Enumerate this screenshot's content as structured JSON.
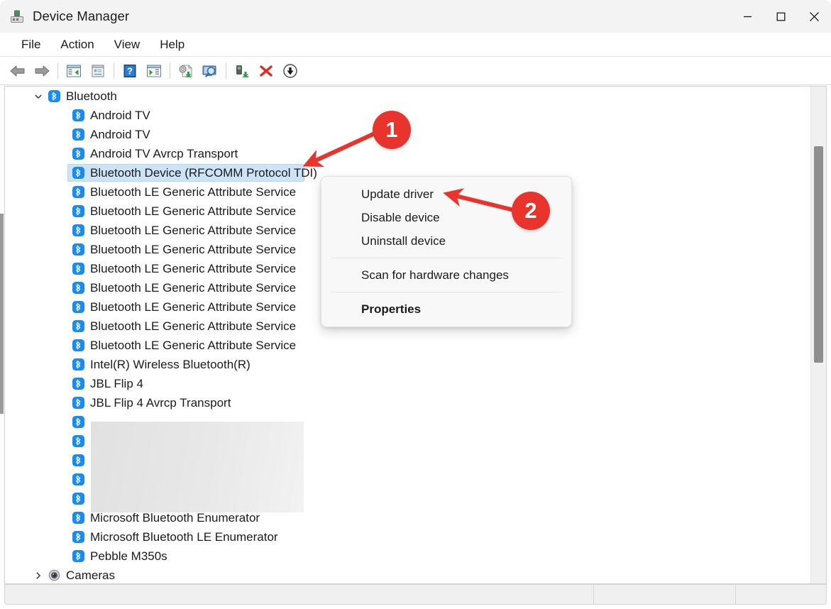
{
  "window": {
    "title": "Device Manager",
    "icon": "device-manager-icon",
    "controls": [
      {
        "name": "minimize",
        "glyph": "minimize-icon"
      },
      {
        "name": "maximize",
        "glyph": "maximize-icon"
      },
      {
        "name": "close",
        "glyph": "close-icon"
      }
    ]
  },
  "menubar": {
    "items": [
      "File",
      "Action",
      "View",
      "Help"
    ]
  },
  "toolbar": {
    "buttons": [
      {
        "name": "back-button",
        "icon": "back-arrow-icon"
      },
      {
        "name": "forward-button",
        "icon": "forward-arrow-icon"
      },
      {
        "name": "separator-1",
        "icon": "separator"
      },
      {
        "name": "show-hide-console-tree-button",
        "icon": "console-tree-icon"
      },
      {
        "name": "properties-button",
        "icon": "properties-window-icon"
      },
      {
        "name": "separator-2",
        "icon": "separator"
      },
      {
        "name": "help-button",
        "icon": "help-question-icon"
      },
      {
        "name": "show-hide-action-pane-button",
        "icon": "action-pane-icon"
      },
      {
        "name": "separator-3",
        "icon": "separator"
      },
      {
        "name": "update-driver-button",
        "icon": "update-driver-icon"
      },
      {
        "name": "scan-for-hardware-changes-button",
        "icon": "scan-monitor-icon"
      },
      {
        "name": "separator-4",
        "icon": "separator"
      },
      {
        "name": "enable-device-button",
        "icon": "enable-device-icon"
      },
      {
        "name": "uninstall-device-button",
        "icon": "red-x-icon"
      },
      {
        "name": "disable-device-button",
        "icon": "down-arrow-circle-icon"
      }
    ]
  },
  "tree": {
    "root_label": "Bluetooth",
    "root_expanded": true,
    "selected_index": 3,
    "items": [
      {
        "label": "Android TV",
        "icon": "bluetooth-icon",
        "redacted": false
      },
      {
        "label": "Android TV",
        "icon": "bluetooth-icon",
        "redacted": false
      },
      {
        "label": "Android TV Avrcp Transport",
        "icon": "bluetooth-icon",
        "redacted": false
      },
      {
        "label": "Bluetooth Device (RFCOMM Protocol TDI)",
        "icon": "bluetooth-icon",
        "redacted": false
      },
      {
        "label": "Bluetooth LE Generic Attribute Service",
        "icon": "bluetooth-icon",
        "redacted": false
      },
      {
        "label": "Bluetooth LE Generic Attribute Service",
        "icon": "bluetooth-icon",
        "redacted": false
      },
      {
        "label": "Bluetooth LE Generic Attribute Service",
        "icon": "bluetooth-icon",
        "redacted": false
      },
      {
        "label": "Bluetooth LE Generic Attribute Service",
        "icon": "bluetooth-icon",
        "redacted": false
      },
      {
        "label": "Bluetooth LE Generic Attribute Service",
        "icon": "bluetooth-icon",
        "redacted": false
      },
      {
        "label": "Bluetooth LE Generic Attribute Service",
        "icon": "bluetooth-icon",
        "redacted": false
      },
      {
        "label": "Bluetooth LE Generic Attribute Service",
        "icon": "bluetooth-icon",
        "redacted": false
      },
      {
        "label": "Bluetooth LE Generic Attribute Service",
        "icon": "bluetooth-icon",
        "redacted": false
      },
      {
        "label": "Bluetooth LE Generic Attribute Service",
        "icon": "bluetooth-icon",
        "redacted": false
      },
      {
        "label": "Intel(R) Wireless Bluetooth(R)",
        "icon": "bluetooth-icon",
        "redacted": false
      },
      {
        "label": "JBL Flip 4",
        "icon": "bluetooth-icon",
        "redacted": false
      },
      {
        "label": "JBL Flip 4 Avrcp Transport",
        "icon": "bluetooth-icon",
        "redacted": false
      },
      {
        "label": "",
        "icon": "bluetooth-icon",
        "redacted": true
      },
      {
        "label": "",
        "icon": "bluetooth-icon",
        "redacted": true
      },
      {
        "label": "",
        "icon": "bluetooth-icon",
        "redacted": true
      },
      {
        "label": "",
        "icon": "bluetooth-icon",
        "redacted": true
      },
      {
        "label": "",
        "icon": "bluetooth-icon",
        "redacted": true
      },
      {
        "label": "Microsoft Bluetooth Enumerator",
        "icon": "bluetooth-icon",
        "redacted": false
      },
      {
        "label": "Microsoft Bluetooth LE Enumerator",
        "icon": "bluetooth-icon",
        "redacted": false
      },
      {
        "label": "Pebble M350s",
        "icon": "bluetooth-icon",
        "redacted": false
      }
    ],
    "next_group": {
      "label": "Cameras",
      "icon": "camera-icon",
      "expanded": false
    }
  },
  "context_menu": {
    "items": [
      {
        "label": "Update driver",
        "bold": false,
        "type": "item"
      },
      {
        "label": "Disable device",
        "bold": false,
        "type": "item"
      },
      {
        "label": "Uninstall device",
        "bold": false,
        "type": "item"
      },
      {
        "type": "separator"
      },
      {
        "label": "Scan for hardware changes",
        "bold": false,
        "type": "item"
      },
      {
        "type": "separator"
      },
      {
        "label": "Properties",
        "bold": true,
        "type": "item"
      }
    ]
  },
  "annotations": {
    "badges": [
      {
        "number": "1",
        "target": "selected-tree-item"
      },
      {
        "number": "2",
        "target": "update-driver-menu-item"
      }
    ],
    "accent_color": "#e8342c"
  },
  "colors": {
    "titlebar_bg": "#f3f3f3",
    "selection_bg": "#cce4f7",
    "bluetooth_blue": "#1a8cf0",
    "menu_bg": "#f8f8f8",
    "annotation_red": "#e8342c"
  },
  "statusbar": {
    "panes": [
      "",
      "",
      ""
    ]
  }
}
